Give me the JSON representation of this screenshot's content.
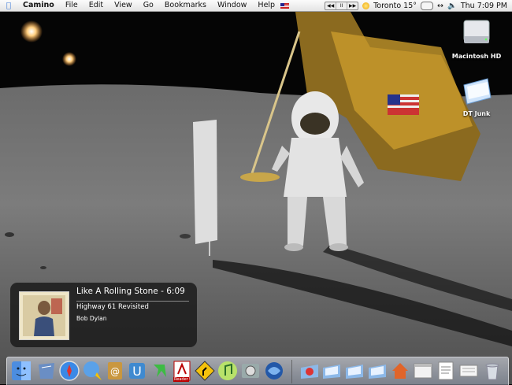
{
  "menubar": {
    "apple_icon": "apple-icon",
    "app_name": "Camino",
    "menus": [
      "File",
      "Edit",
      "View",
      "Go",
      "Bookmarks",
      "Window",
      "Help"
    ],
    "itunes_controls": [
      "◀◀",
      "II",
      "▶▶"
    ],
    "weather": "Toronto 15°",
    "clock": "Thu 7:09 PM",
    "accent_color": "#3a78d8"
  },
  "desktop": {
    "icons": [
      {
        "label": "Macintosh HD",
        "icon": "hard-drive-icon"
      },
      {
        "label": "DT Junk",
        "icon": "folder-icon"
      }
    ]
  },
  "notification": {
    "track": "Like A Rolling Stone - 6:09",
    "album": "Highway 61 Revisited",
    "artist": "Bob Dylan"
  },
  "dock": {
    "apps": [
      {
        "name": "Finder",
        "icon": "finder-icon"
      },
      {
        "name": "Mail",
        "icon": "mail-icon"
      },
      {
        "name": "Safari",
        "icon": "safari-icon"
      },
      {
        "name": "iChat",
        "icon": "ichat-icon"
      },
      {
        "name": "Address Book",
        "icon": "address-book-icon"
      },
      {
        "name": "Unison",
        "icon": "unison-icon"
      },
      {
        "name": "Growl",
        "icon": "growl-icon"
      },
      {
        "name": "Adobe Reader",
        "icon": "adobe-reader-icon",
        "badge": "Reader"
      },
      {
        "name": "Road Sign App",
        "icon": "road-sign-icon"
      },
      {
        "name": "iTunes",
        "icon": "itunes-icon"
      },
      {
        "name": "System Preferences",
        "icon": "system-preferences-icon"
      },
      {
        "name": "Camino",
        "icon": "camino-icon"
      }
    ],
    "docs": [
      {
        "name": "Application Folder",
        "icon": "application-folder-icon"
      },
      {
        "name": "Folder",
        "icon": "folder-icon"
      },
      {
        "name": "Folder",
        "icon": "folder-icon"
      },
      {
        "name": "Folder",
        "icon": "folder-icon"
      },
      {
        "name": "Home",
        "icon": "home-icon"
      },
      {
        "name": "Window",
        "icon": "window-icon"
      },
      {
        "name": "Document",
        "icon": "document-icon"
      },
      {
        "name": "Document",
        "icon": "document-icon"
      },
      {
        "name": "Trash",
        "icon": "trash-icon"
      }
    ]
  }
}
